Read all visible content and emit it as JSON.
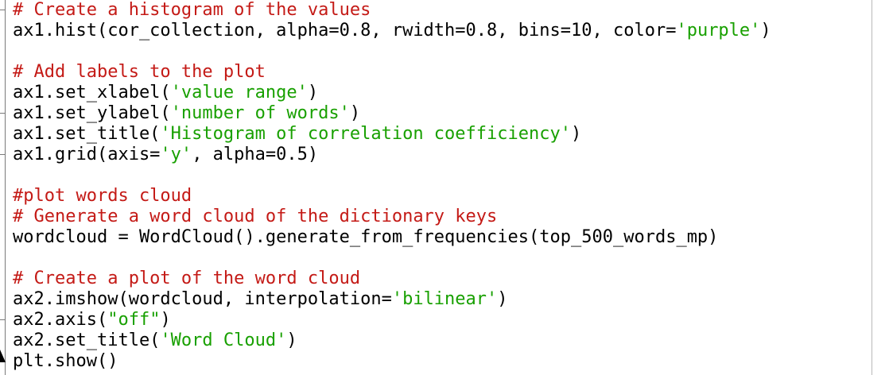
{
  "editor": {
    "theme_colors": {
      "comment": "#c41a16",
      "string": "#18a000",
      "plain": "#000000",
      "background": "#ffffff"
    },
    "lines": [
      [
        {
          "t": "comment",
          "v": "# Create a histogram of the values"
        }
      ],
      [
        {
          "t": "plain",
          "v": "ax1.hist(cor_collection, alpha=0.8, rwidth=0.8, bins=10, color="
        },
        {
          "t": "string",
          "v": "'purple'"
        },
        {
          "t": "plain",
          "v": ")"
        }
      ],
      [],
      [
        {
          "t": "comment",
          "v": "# Add labels to the plot"
        }
      ],
      [
        {
          "t": "plain",
          "v": "ax1.set_xlabel("
        },
        {
          "t": "string",
          "v": "'value range'"
        },
        {
          "t": "plain",
          "v": ")"
        }
      ],
      [
        {
          "t": "plain",
          "v": "ax1.set_ylabel("
        },
        {
          "t": "string",
          "v": "'number of words'"
        },
        {
          "t": "plain",
          "v": ")"
        }
      ],
      [
        {
          "t": "plain",
          "v": "ax1.set_title("
        },
        {
          "t": "string",
          "v": "'Histogram of correlation coefficiency'"
        },
        {
          "t": "plain",
          "v": ")"
        }
      ],
      [
        {
          "t": "plain",
          "v": "ax1.grid(axis="
        },
        {
          "t": "string",
          "v": "'y'"
        },
        {
          "t": "plain",
          "v": ", alpha=0.5)"
        }
      ],
      [],
      [
        {
          "t": "comment",
          "v": "#plot words cloud"
        }
      ],
      [
        {
          "t": "comment",
          "v": "# Generate a word cloud of the dictionary keys"
        }
      ],
      [
        {
          "t": "plain",
          "v": "wordcloud = WordCloud().generate_from_frequencies(top_500_words_mp)"
        }
      ],
      [],
      [
        {
          "t": "comment",
          "v": "# Create a plot of the word cloud"
        }
      ],
      [
        {
          "t": "plain",
          "v": "ax2.imshow(wordcloud, interpolation="
        },
        {
          "t": "string",
          "v": "'bilinear'"
        },
        {
          "t": "plain",
          "v": ")"
        }
      ],
      [
        {
          "t": "plain",
          "v": "ax2.axis("
        },
        {
          "t": "string",
          "v": "\"off\""
        },
        {
          "t": "plain",
          "v": ")"
        }
      ],
      [
        {
          "t": "plain",
          "v": "ax2.set_title("
        },
        {
          "t": "string",
          "v": "'Word Cloud'"
        },
        {
          "t": "plain",
          "v": ")"
        }
      ],
      [
        {
          "t": "plain",
          "v": "plt.show()"
        }
      ]
    ]
  }
}
